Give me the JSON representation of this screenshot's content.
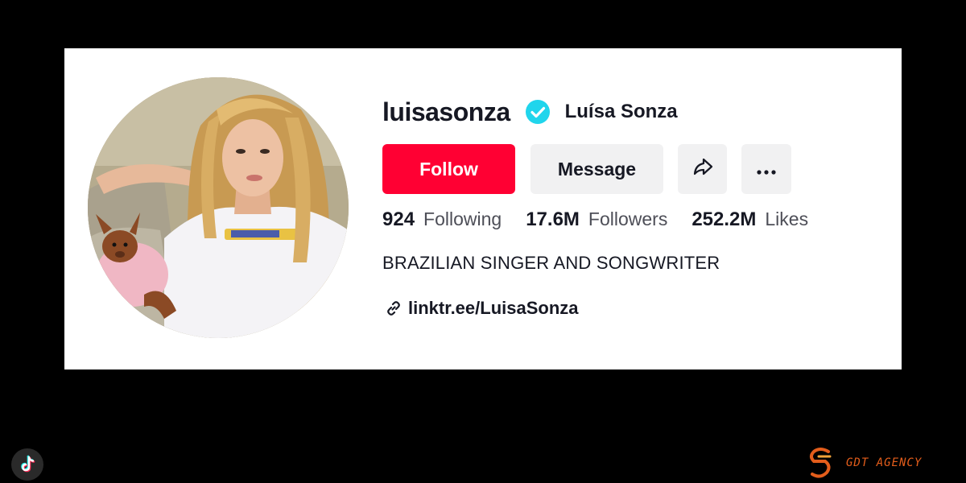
{
  "profile": {
    "username": "luisasonza",
    "display_name": "Luísa Sonza",
    "verified": true,
    "avatar_description_icon": "profile-photo-icon"
  },
  "actions": {
    "follow_label": "Follow",
    "message_label": "Message",
    "share_icon": "share-icon",
    "more_icon": "more-icon"
  },
  "stats": [
    {
      "value": "924",
      "label": "Following"
    },
    {
      "value": "17.6M",
      "label": "Followers"
    },
    {
      "value": "252.2M",
      "label": "Likes"
    }
  ],
  "bio": "BRAZILIAN SINGER AND SONGWRITER",
  "link": {
    "icon": "link-icon",
    "text": "linktr.ee/LuisaSonza"
  },
  "branding": {
    "tiktok_icon": "tiktok-logo-icon",
    "agency_name": "GDT AGENCY"
  },
  "colors": {
    "follow_button": "#ff0033",
    "secondary_button": "#f1f1f2",
    "verified_badge": "#20d5ec",
    "agency_accent": "#e35d1b",
    "background": "#000000",
    "card": "#ffffff"
  }
}
